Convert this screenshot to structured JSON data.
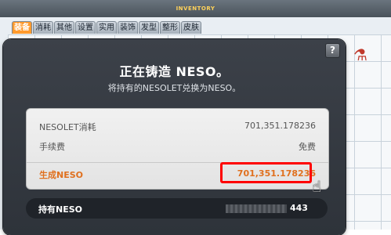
{
  "inventory": {
    "title": "INVENTORY",
    "tabs": [
      "装备",
      "消耗",
      "其他",
      "设置",
      "实用",
      "装饰",
      "发型",
      "整形",
      "皮肤"
    ],
    "active_tab": 0,
    "item_icon": "potion-icon"
  },
  "dialog": {
    "help_label": "?",
    "title": "正在铸造 NESO。",
    "subtitle": "将持有的NESOLET兑换为NESO。",
    "rows": [
      {
        "label": "NESOLET消耗",
        "value": "701,351.178236"
      },
      {
        "label": "手续费",
        "value": "免费"
      },
      {
        "label": "生成NESO",
        "value": "701,351.178236"
      }
    ],
    "owned": {
      "label": "持有NESO",
      "value_suffix": "443"
    },
    "highlight_color": "#ff0000",
    "accent_color": "#e0701e"
  }
}
